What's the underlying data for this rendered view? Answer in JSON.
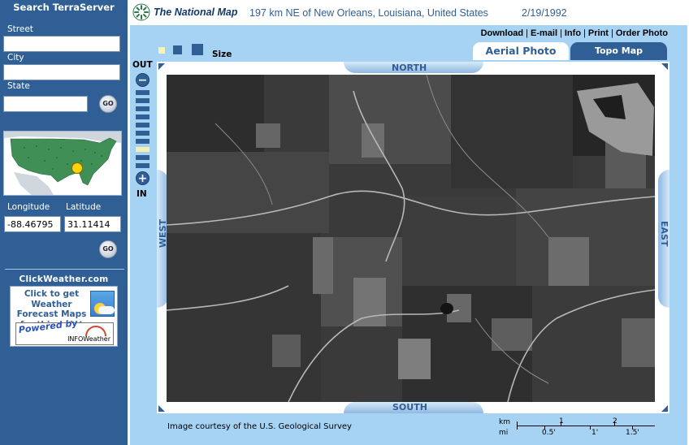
{
  "sidebar": {
    "title": "Search TerraServer",
    "street_label": "Street",
    "street_value": "",
    "city_label": "City",
    "city_value": "",
    "state_label": "State",
    "state_value": "",
    "go_label": "GO",
    "longitude_label": "Longitude",
    "latitude_label": "Latitude",
    "longitude_value": "-88.46795",
    "latitude_value": "31.11414",
    "clickweather": {
      "title": "ClickWeather.com",
      "text": "Click to get Weather Forecast Maps for this point",
      "powered_by": "Powered by",
      "logo": "INFOWeather"
    }
  },
  "header": {
    "logo": "The National Map",
    "location": "197 km NE of New Orleans, Louisiana, United States",
    "date": "2/19/1992"
  },
  "links": [
    "Download",
    "E-mail",
    "Info",
    "Print",
    "Order Photo"
  ],
  "size_label": "Size",
  "tabs": {
    "aerial": "Aerial Photo",
    "topo": "Topo Map"
  },
  "zoom": {
    "out_label": "OUT",
    "in_label": "IN",
    "minus": "−",
    "plus": "+",
    "active_level": 7,
    "levels": 10
  },
  "compass": {
    "north": "NORTH",
    "south": "SOUTH",
    "east": "EAST",
    "west": "WEST"
  },
  "footer": {
    "courtesy": "Image courtesy of the U.S. Geological Survey",
    "scale": {
      "km_label": "km",
      "mi_label": "mi",
      "km_ticks": [
        "1",
        "2"
      ],
      "mi_ticks": [
        "0.5'",
        "1'",
        "1.5'"
      ]
    }
  },
  "colors": {
    "sidebar": "#2f5f95",
    "panel": "#a6d2f4",
    "accent": "#2f5f95",
    "zoom_active": "#f3f0b0",
    "marker": "#ffd400"
  }
}
